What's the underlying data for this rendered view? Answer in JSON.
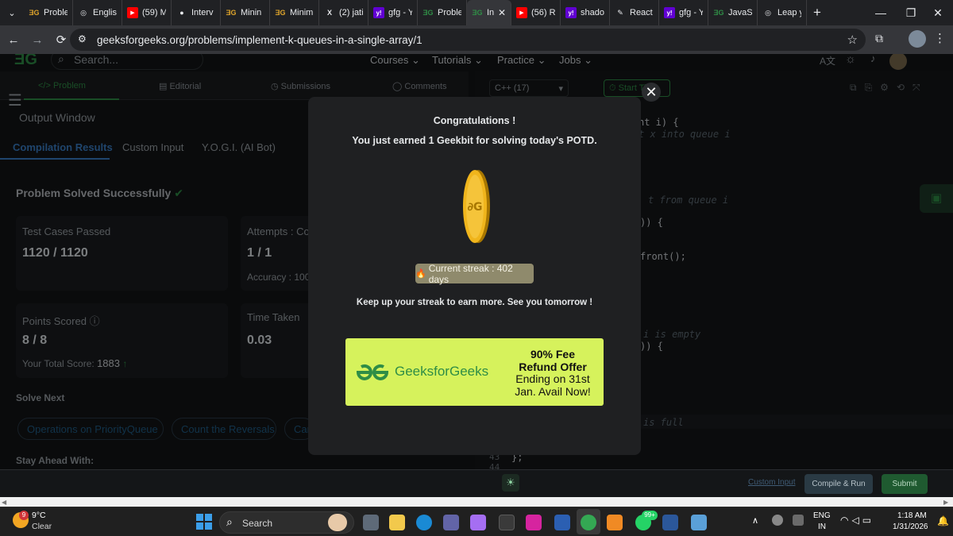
{
  "browser": {
    "tabs": [
      {
        "label": "Proble",
        "icon": "gfg-icon",
        "color": "#e0a52b"
      },
      {
        "label": "Englis",
        "icon": "globe-icon",
        "color": "#e8eaed"
      },
      {
        "label": "(59) M",
        "icon": "youtube-icon",
        "color": "#ff0000"
      },
      {
        "label": "Interv",
        "icon": "github-icon",
        "color": "#e8eaed"
      },
      {
        "label": "Minin",
        "icon": "gfg-icon",
        "color": "#e0a52b"
      },
      {
        "label": "Minim",
        "icon": "gfg-icon",
        "color": "#e0a52b"
      },
      {
        "label": "(2) jati",
        "icon": "x-icon",
        "color": "#e8eaed"
      },
      {
        "label": "gfg - Y",
        "icon": "yahoo-icon",
        "color": "#6001d2"
      },
      {
        "label": "Proble",
        "icon": "gfg-icon",
        "color": "#2f8d46"
      },
      {
        "label": "In",
        "icon": "gfg-icon",
        "color": "#2f8d46",
        "active": true
      },
      {
        "label": "(56) R",
        "icon": "youtube-icon",
        "color": "#ff0000"
      },
      {
        "label": "shado",
        "icon": "yahoo-icon",
        "color": "#6001d2"
      },
      {
        "label": "React",
        "icon": "pen-icon",
        "color": "#e8eaed"
      },
      {
        "label": "gfg - Y",
        "icon": "yahoo-icon",
        "color": "#6001d2"
      },
      {
        "label": "JavaSc",
        "icon": "gfg-icon",
        "color": "#2f8d46"
      },
      {
        "label": "Leap y",
        "icon": "globe-icon",
        "color": "#e8eaed"
      }
    ],
    "url": "geeksforgeeks.org/problems/implement-k-queues-in-a-single-array/1"
  },
  "gfg_nav": {
    "search_placeholder": "Search...",
    "menus": [
      "Courses",
      "Tutorials",
      "Practice",
      "Jobs"
    ]
  },
  "problem_tabs": [
    "Problem",
    "Editorial",
    "Submissions",
    "Comments"
  ],
  "left": {
    "output_window": "Output Window",
    "result_tabs": [
      "Compilation Results",
      "Custom Input",
      "Y.O.G.I. (AI Bot)"
    ],
    "solved_title": "Problem Solved Successfully",
    "test_cases_label": "Test Cases Passed",
    "test_cases_value": "1120 / 1120",
    "attempts_label": "Attempts : Corr",
    "attempts_value": "1 / 1",
    "accuracy_label": "Accuracy : 100",
    "points_label": "Points Scored",
    "points_value": "8 / 8",
    "total_score_label": "Your Total Score:",
    "total_score_value": "1883",
    "time_label": "Time Taken",
    "time_value": "0.03",
    "solve_next": "Solve Next",
    "chips": [
      "Operations on PriorityQueue",
      "Count the Reversals",
      "Car"
    ],
    "stay_ahead": "Stay Ahead With:"
  },
  "editor": {
    "language": "C++ (17)",
    "start_timer": "Start Ti",
    "code_fragments": [
      "nt i) {",
      "t x into queue i",
      "t from queue i",
      ")) {",
      "front();",
      "i is empty",
      ")) {",
      "is full",
      "};"
    ],
    "line_numbers": [
      "43",
      "44"
    ]
  },
  "modal": {
    "title": "Congratulations !",
    "subtitle": "You just earned 1 Geekbit for solving today's POTD.",
    "streak": "Current streak : 402 days",
    "streak_emoji": "🔥",
    "message": "Keep up your streak to earn more. See you tomorrow !",
    "banner_brand": "GeeksforGeeks",
    "banner_offer_bold": "90% Fee Refund Offer",
    "banner_offer_text": "Ending on 31st Jan. Avail Now!"
  },
  "actions": {
    "custom_input": "Custom Input",
    "compile_run": "Compile & Run",
    "submit": "Submit"
  },
  "taskbar": {
    "weather_temp": "9°C",
    "weather_desc": "Clear",
    "weather_badge": "9",
    "search": "Search",
    "lang_top": "ENG",
    "lang_bottom": "IN",
    "time": "1:18 AM",
    "date": "1/31/2026",
    "whatsapp_badge": "99+"
  },
  "colors": {
    "gfg_green": "#2f8d46",
    "banner_bg": "#d6f25c",
    "submit_bg": "#2f8d46"
  }
}
